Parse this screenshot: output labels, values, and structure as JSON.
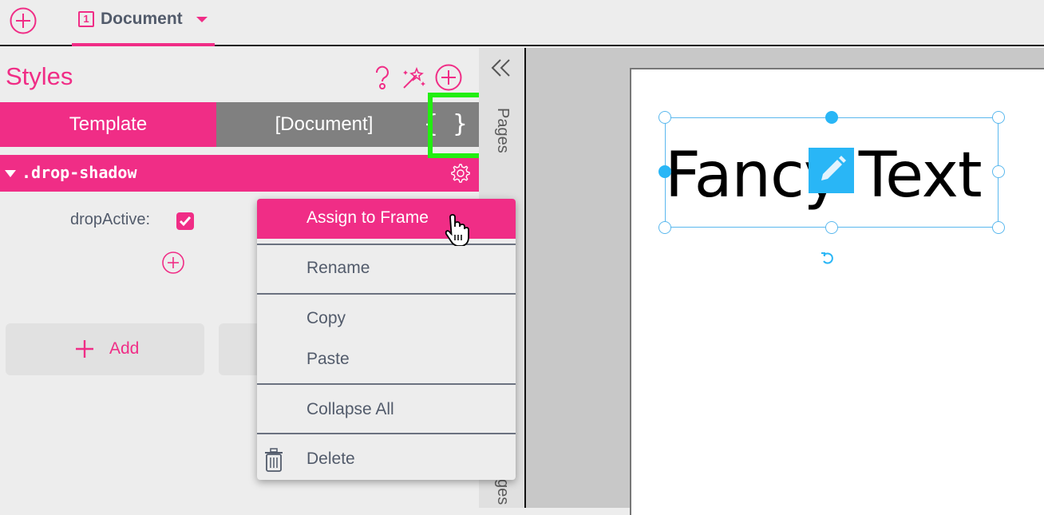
{
  "topbar": {
    "add_icon": "plus-circle-icon",
    "document_tab": {
      "number": "1",
      "label": "Document",
      "caret_icon": "caret-down-icon"
    }
  },
  "styles_panel": {
    "title": "Styles",
    "header_icons": [
      "help-icon",
      "magic-wand-icon",
      "plus-circle-icon"
    ],
    "tabs": [
      {
        "label": "Template",
        "active": true
      },
      {
        "label": "[Document]",
        "active": false
      }
    ],
    "code_icon_label": "{ }",
    "style_entry": {
      "name": ".drop-shadow",
      "expanded": true,
      "settings_icon": "gear-icon",
      "properties": [
        {
          "label": "dropActive:",
          "checked": true
        }
      ]
    },
    "add_button_label": "Add"
  },
  "side_strip": {
    "collapse_icon": "double-chevron-left-icon",
    "label_top": "Pages",
    "label_bottom": "ges"
  },
  "canvas": {
    "text": "Fancy Text"
  },
  "context_menu": {
    "items": [
      {
        "label": "Assign to Frame",
        "active": true
      },
      {
        "label": "Rename"
      },
      {
        "label": "Copy"
      },
      {
        "label": "Paste"
      },
      {
        "label": "Collapse All"
      },
      {
        "label": "Delete",
        "icon": "trash-icon"
      }
    ]
  },
  "colors": {
    "accent": "#f02d86",
    "tab_inactive": "#808080",
    "selection": "#29b6f6",
    "highlight": "#22ee11",
    "text_muted": "#525b6b"
  }
}
